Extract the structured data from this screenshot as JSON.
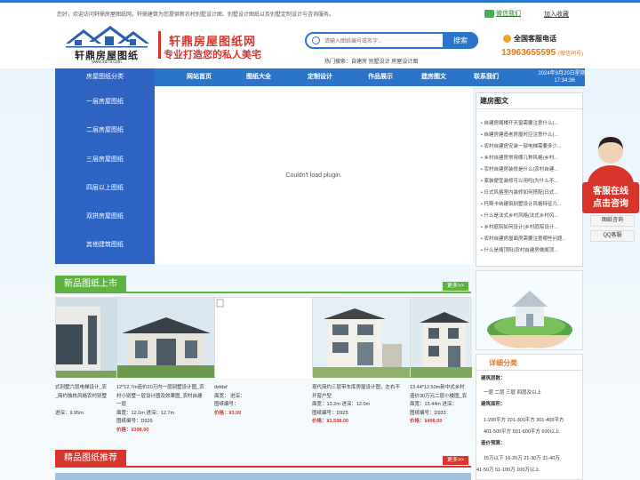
{
  "topbar": {
    "welcome": "您好，欢迎访问轩鼎房屋图纸网，轩鼎建筑为您提供新农村别墅设计图、别墅设计图纸以及别墅定制设计与咨询服务。",
    "wechat": "微信我们",
    "favorite": "加入收藏"
  },
  "logo": {
    "name": "轩鼎房屋图纸",
    "url": "www.xd79.com"
  },
  "slogan": {
    "line1": "轩鼎房屋图纸网",
    "line2": "专业打造您的私人美宅"
  },
  "search": {
    "placeholder": "请输入图纸编号或名字...",
    "button": "搜索",
    "hot_label": "热门搜索：",
    "hot_items": "自建房  别墅设计  房屋设计图"
  },
  "contact": {
    "label": "全国客服电话",
    "phone": "13963655595",
    "phone_note": "(微信同号)"
  },
  "nav": {
    "category": "房屋图纸分类",
    "items": [
      "网站首页",
      "图纸大全",
      "定制设计",
      "作品展示",
      "建房图文",
      "联系我们"
    ],
    "date": "2024年9月20日星期五",
    "time": "17:34:36"
  },
  "leftmenu": [
    "一层房屋图纸",
    "二层房屋图纸",
    "三层房屋图纸",
    "四层以上图纸",
    "双拼房屋图纸",
    "其他建筑图纸"
  ],
  "plugin": "Couldn't load plugin.",
  "news": {
    "title": "建房图文",
    "items": [
      "自建房阁楼开天窗需要注意什么(...",
      "自建房建造老房屋时应注意什么(...",
      "农村自建房安装一部电梯需要多少...",
      "乡村自建房常用哪几种风格(乡村...",
      "农村自建房装修是什么(农村自建...",
      "家装便宜装修可以用吗(为什么不...",
      "日式风格室内装修如何搭配(日式...",
      "托斯卡纳建筑别墅设计风格特征介...",
      "什么是法式乡村风格(法式乡村风...",
      "乡村庭院如何设计(乡村庭院设计...",
      "农村自建房屋面房需要注意哪些问题...",
      "什么是阁顶阳(农村自建房做阁顶..."
    ]
  },
  "new_section": {
    "title": "新品图纸上市",
    "more": "更多>>"
  },
  "cards": [
    {
      "title": "式别墅六层电梯设计_农",
      "line2": "_简约独栋风格农村别墅",
      "line3": "",
      "w": "进深：9.95m",
      "code": "",
      "price": ""
    },
    {
      "title": "12*12.7m造价20万内一层别墅设计图_农",
      "line2": "村小别墅一层设计图及效果图_农村自建",
      "line3": "一层",
      "w": "面宽：12.0m 进深：12.7m",
      "code": "图纸编号：D926",
      "price": "价格：¥398.00"
    },
    {
      "title": "dsfdsf",
      "line2": "面宽： 进深：",
      "line3": "图纸编号：",
      "w": "",
      "code": "",
      "price": "价格：¥3.00"
    },
    {
      "title": "现代简约三层带车库房屋设计图，左右不",
      "line2": "开窗户型",
      "line3": "",
      "w": "面宽：13.2m 进深：12.0m",
      "code": "图纸编号：D925",
      "price": "价格：¥1,598.00"
    },
    {
      "title": "13.44*12.50m新中式乡村",
      "line2": "造价30万元二层小楼图_农",
      "line3": "",
      "w": "面宽：13.44m 进深：",
      "code": "图纸编号：D933",
      "price": "价格：¥498.00"
    }
  ],
  "fine_section": {
    "title": "精品图纸推荐",
    "more": "更多>>"
  },
  "detail": {
    "title": "详细分类",
    "build_label": "建筑层数：",
    "layers": "一层  二层  三层  四层及以上",
    "area_label": "建筑面积：",
    "areas1": "1-200平方  201-300平方  301-400平方",
    "areas2": "401-500平方  501-600平方  600以上",
    "cost_label": "造价预算：",
    "cost1": "15万以下  16-20万  21-30万  31-40万",
    "cost2": "41-50万  51-100万  100万以上"
  },
  "float": {
    "service": "客服在线\n点击咨询",
    "consult": "图纸咨询",
    "qq": "QQ客服"
  }
}
